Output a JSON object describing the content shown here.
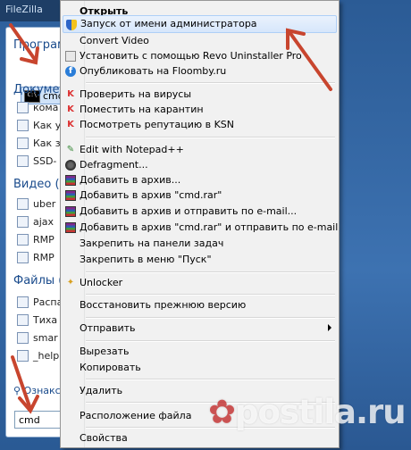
{
  "window_title": "FileZilla",
  "start_menu": {
    "sections": {
      "programs": "Програм",
      "documents": "Докумен",
      "video": "Видео (2",
      "files": "Файлы ("
    },
    "program_item": "cmd",
    "document_items": [
      "кома",
      "Как у",
      "Как з",
      "SSD-"
    ],
    "video_items": [
      "uber",
      "ajax",
      "RMP",
      "RMP"
    ],
    "file_items": [
      "Распа",
      "Тиха",
      "smar",
      "_help"
    ],
    "search_link": "Ознакс",
    "search_value": "cmd"
  },
  "context_menu": {
    "items": [
      {
        "label": "Открыть",
        "bold": true,
        "icon": "none"
      },
      {
        "label": "Запуск от имени администратора",
        "icon": "shield-icon",
        "highlighted": true
      },
      {
        "label": "Convert Video",
        "icon": "none"
      },
      {
        "label": "Установить с помощью Revo Uninstaller Pro",
        "icon": "revo-icon"
      },
      {
        "label": "Опубликовать на Floomby.ru",
        "icon": "floomby-icon"
      },
      {
        "label": "Проверить на вирусы",
        "icon": "kaspersky-icon"
      },
      {
        "label": "Поместить на карантин",
        "icon": "kaspersky-icon"
      },
      {
        "label": "Посмотреть репутацию в KSN",
        "icon": "kaspersky-icon"
      },
      {
        "label": "Edit with Notepad++",
        "icon": "notepadpp-icon"
      },
      {
        "label": "Defragment...",
        "icon": "defrag-icon"
      },
      {
        "label": "Добавить в архив...",
        "icon": "winrar-icon"
      },
      {
        "label": "Добавить в архив \"cmd.rar\"",
        "icon": "winrar-icon"
      },
      {
        "label": "Добавить в архив и отправить по e-mail...",
        "icon": "winrar-icon"
      },
      {
        "label": "Добавить в архив \"cmd.rar\" и отправить по e-mail",
        "icon": "winrar-icon"
      },
      {
        "label": "Закрепить на панели задач",
        "icon": "none"
      },
      {
        "label": "Закрепить в меню \"Пуск\"",
        "icon": "none"
      },
      {
        "label": "Unlocker",
        "icon": "unlocker-icon"
      },
      {
        "label": "Восстановить прежнюю версию",
        "icon": "none"
      },
      {
        "label": "Отправить",
        "icon": "none",
        "submenu": true
      },
      {
        "label": "Вырезать",
        "icon": "none"
      },
      {
        "label": "Копировать",
        "icon": "none"
      },
      {
        "label": "Удалить",
        "icon": "none"
      },
      {
        "label": "Расположение файла",
        "icon": "none"
      },
      {
        "label": "Свойства",
        "icon": "none"
      }
    ]
  },
  "watermark": {
    "text": "postila.ru"
  },
  "colors": {
    "highlight": "#d6e6fb",
    "arrow": "#c8452e"
  }
}
